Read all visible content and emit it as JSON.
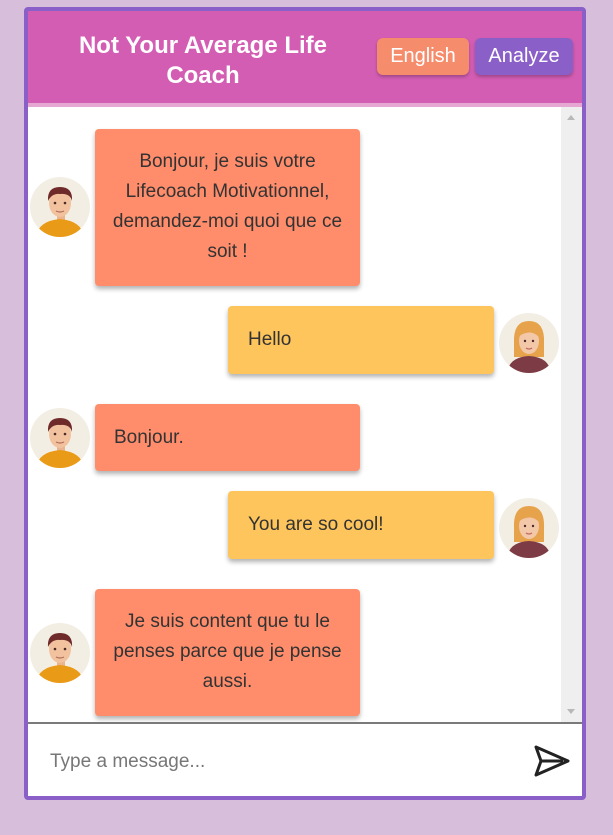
{
  "header": {
    "title": "Not Your Average Life Coach",
    "language_button": "English",
    "analyze_button": "Analyze"
  },
  "messages": [
    {
      "sender": "bot",
      "text": "Bonjour, je suis votre Lifecoach Motivationnel, demandez-moi quoi que ce soit !"
    },
    {
      "sender": "user",
      "text": "Hello"
    },
    {
      "sender": "bot",
      "text": "Bonjour."
    },
    {
      "sender": "user",
      "text": "You are so cool!"
    },
    {
      "sender": "bot",
      "text": "Je suis content que tu le penses parce que je pense aussi."
    }
  ],
  "composer": {
    "placeholder": "Type a message...",
    "send_icon": "send-icon"
  },
  "colors": {
    "page_background": "#d7bfdb",
    "frame_border": "#8a5fc8",
    "header": "#d45db4",
    "bot_bubble": "#ff8d6b",
    "user_bubble": "#fec55c",
    "analyze_button": "#8a5fc8",
    "language_button": "#f58c6c"
  }
}
